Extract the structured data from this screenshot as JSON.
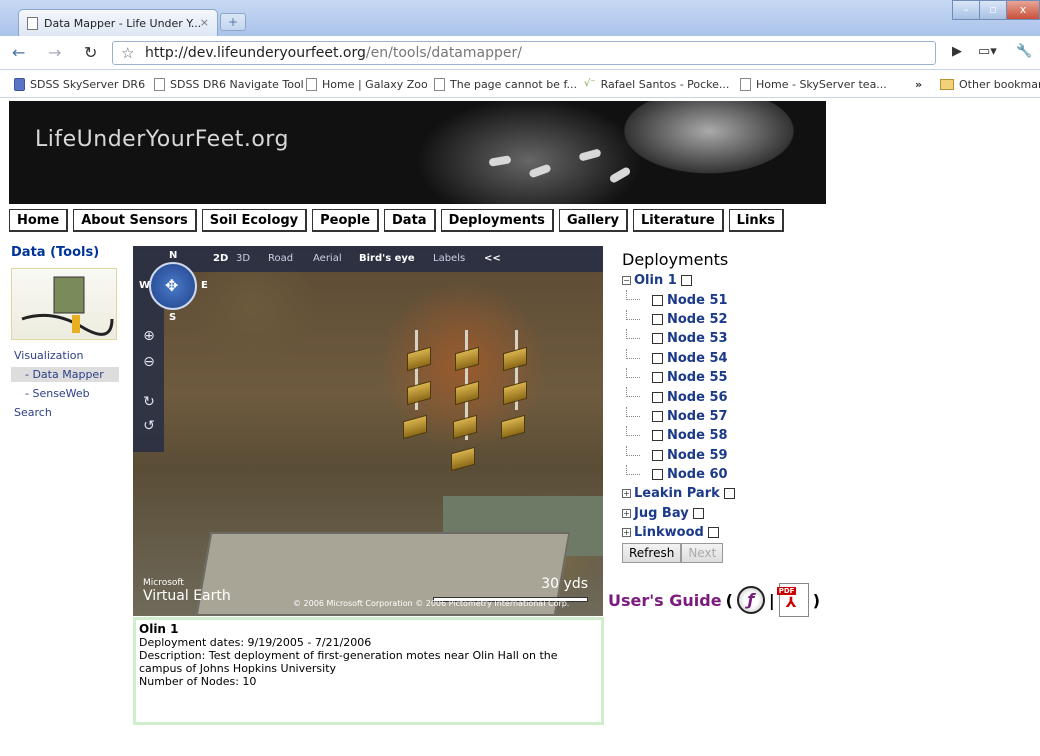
{
  "browser": {
    "tab_title": "Data Mapper - Life Under Y...",
    "tab_close": "×",
    "new_tab": "+",
    "url_host": "http://dev.lifeunderyourfeet.org",
    "url_path": "/en/tools/datamapper/",
    "bookmarks": [
      "SDSS SkyServer DR6",
      "SDSS DR6 Navigate Tool",
      "Home | Galaxy Zoo",
      "The page cannot be f...",
      "Rafael Santos - Pocke...",
      "Home - SkyServer tea..."
    ],
    "bookmark_overflow": "»",
    "other_bookmarks": "Other bookmarks"
  },
  "site": {
    "logo_text": "LifeUnderYourFeet.org",
    "menu": [
      "Home",
      "About Sensors",
      "Soil Ecology",
      "People",
      "Data",
      "Deployments",
      "Gallery",
      "Literature",
      "Links"
    ]
  },
  "sidebar": {
    "heading": "Data (Tools)",
    "links": [
      {
        "label": "Visualization",
        "selected": false
      },
      {
        "label": "- Data Mapper",
        "selected": true
      },
      {
        "label": "- SenseWeb",
        "selected": false
      },
      {
        "label": "Search",
        "selected": false
      }
    ]
  },
  "map": {
    "toolbar": [
      "2D",
      "3D",
      "Road",
      "Aerial",
      "Bird's eye",
      "Labels",
      "<<"
    ],
    "compass": {
      "n": "N",
      "s": "S",
      "e": "E",
      "w": "W"
    },
    "scale_text": "30 yds",
    "logo_small": "Microsoft",
    "logo_big": "Virtual Earth",
    "copyright": "© 2006 Microsoft Corporation   © 2006 Pictometry International Corp."
  },
  "info": {
    "name": "Olin 1",
    "dates": "Deployment dates: 9/19/2005 - 7/21/2006",
    "description": "Description: Test deployment of first-generation motes near Olin Hall on the campus of Johns Hopkins University",
    "nodes": "Number of Nodes: 10"
  },
  "deployments": {
    "heading": "Deployments",
    "olin": "Olin 1",
    "nodes": [
      "Node 51",
      "Node 52",
      "Node 53",
      "Node 54",
      "Node 55",
      "Node 56",
      "Node 57",
      "Node 58",
      "Node 59",
      "Node 60"
    ],
    "others": [
      "Leakin Park",
      "Jug Bay",
      "Linkwood"
    ],
    "refresh": "Refresh",
    "next": "Next"
  },
  "guide": {
    "label": "User's Guide",
    "open": "(",
    "sep": "|",
    "close": ")",
    "pdf_tag": "PDF"
  }
}
